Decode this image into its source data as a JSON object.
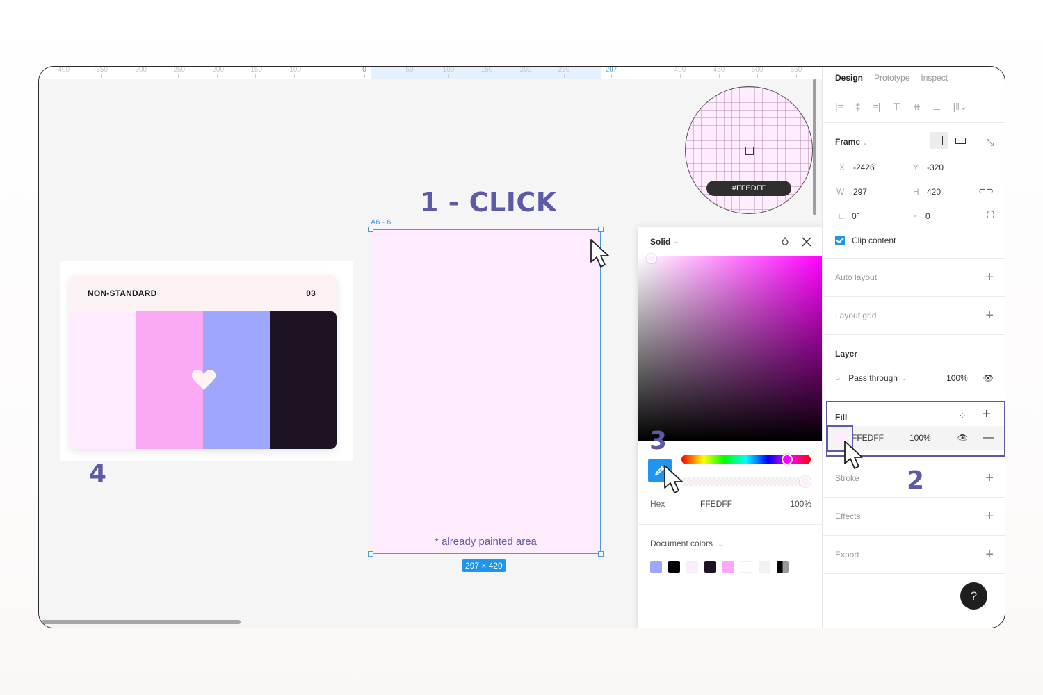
{
  "ruler": {
    "ticks": [
      "-400",
      "-350",
      "-300",
      "-250",
      "-200",
      "-150",
      "-100",
      "0",
      "50",
      "100",
      "150",
      "200",
      "250",
      "297",
      "400",
      "450",
      "500",
      "550"
    ],
    "selection_start": "0",
    "selection_end": "297"
  },
  "annotations": {
    "step1": "1 - CLICK",
    "step2": "2",
    "step3": "3",
    "step4": "4"
  },
  "card": {
    "title": "NON-STANDARD",
    "number": "03",
    "palette": [
      "#FFEDFF",
      "#FBA9F5",
      "#9EA6FD",
      "#1E1323"
    ],
    "icon": "heart-icon"
  },
  "frame": {
    "label": "A6 - 6",
    "note": "* already painted area",
    "size_badge": "297 × 420",
    "fill": "#FFEDFF"
  },
  "magnifier": {
    "hex": "#FFEDFF"
  },
  "color_picker": {
    "mode": "Solid",
    "hex_label": "Hex",
    "hex_value": "FFEDFF",
    "opacity": "100%",
    "document_colors_label": "Document colors",
    "document_colors": [
      "#9EA6FD",
      "#000000",
      "#FFEDFF",
      "#1E1323",
      "#FBA9F5",
      "#FFFFFF",
      "#F2F2F2",
      "mixed"
    ],
    "icons": [
      "style-icon",
      "close-icon",
      "eyedropper-icon"
    ]
  },
  "panel": {
    "tabs": [
      {
        "label": "Design",
        "active": true
      },
      {
        "label": "Prototype",
        "active": false
      },
      {
        "label": "Inspect",
        "active": false
      }
    ],
    "frame": {
      "title": "Frame",
      "x_label": "X",
      "x": "-2426",
      "y_label": "Y",
      "y": "-320",
      "w_label": "W",
      "w": "297",
      "h_label": "H",
      "h": "420",
      "rotation": "0°",
      "radius": "0",
      "clip_content": "Clip content",
      "clip_checked": true
    },
    "auto_layout": "Auto layout",
    "layout_grid": "Layout grid",
    "layer": {
      "title": "Layer",
      "blend": "Pass through",
      "opacity": "100%"
    },
    "fill": {
      "title": "Fill",
      "hex": "FFEDFF",
      "opacity": "100%",
      "color": "#FFEDFF"
    },
    "stroke": "Stroke",
    "effects": "Effects",
    "export": "Export",
    "help": "?"
  },
  "colors": {
    "accent": "#1E96F0",
    "annotation": "#5D5AA6",
    "selection": "#4A9CE0"
  }
}
